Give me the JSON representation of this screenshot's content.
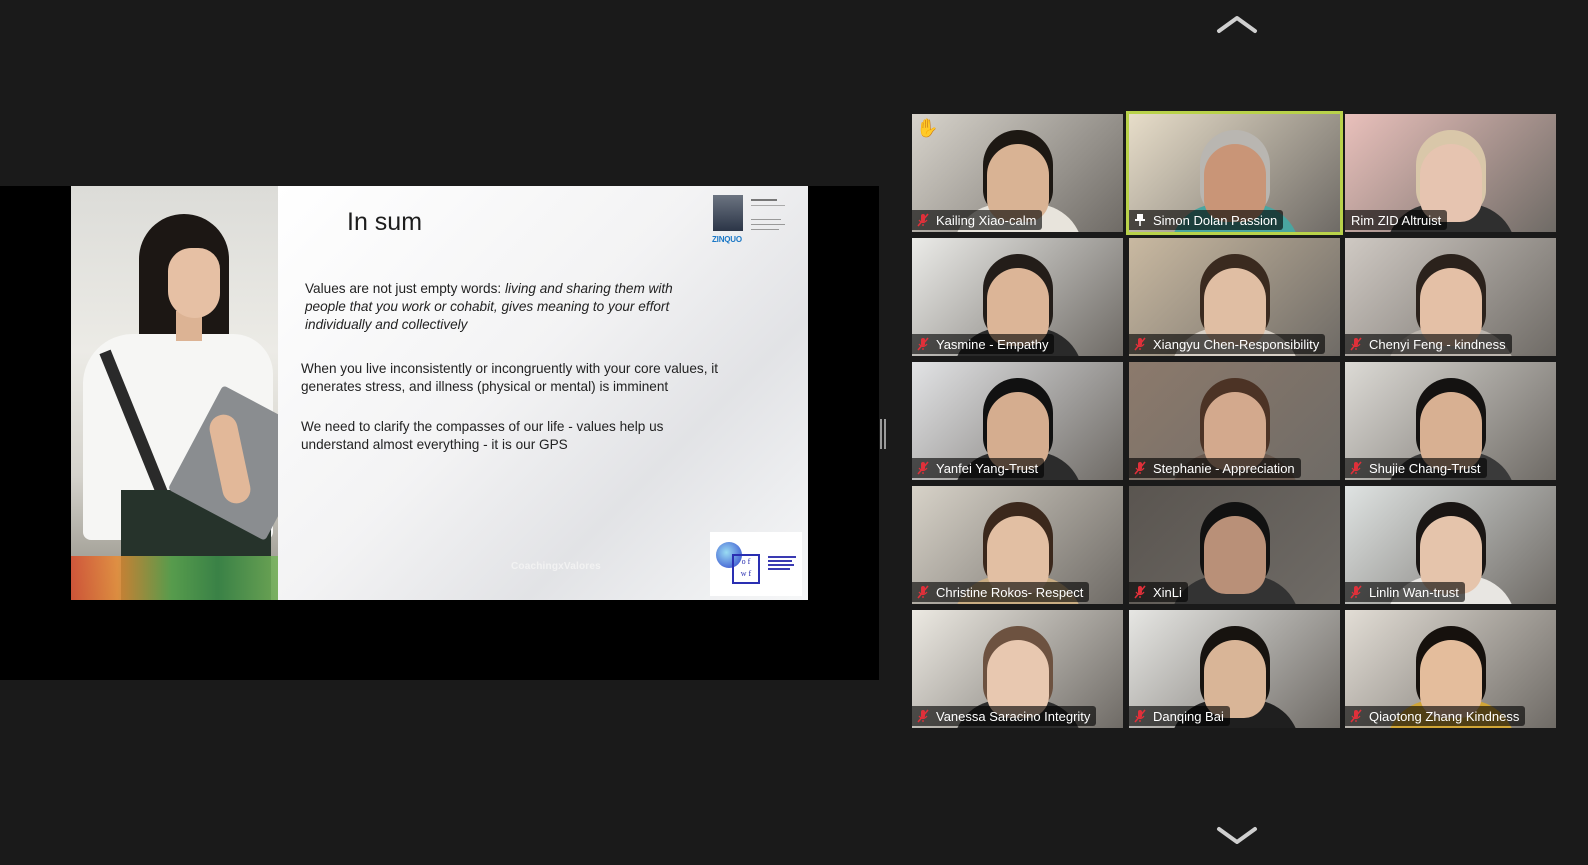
{
  "slide": {
    "title": "In sum",
    "para1_plain": "Values are not just empty words: ",
    "para1_italic": "living and sharing them  with people that you work or cohabit,  gives meaning to your effort individually and collectively",
    "para2": "When you live inconsistently or incongruently with your core values, it  generates  stress, and illness (physical or mental)  is imminent",
    "para3": "We need to clarify the compasses of our life - values help us understand almost everything - it is our GPS",
    "footer": "CoachingxValores",
    "card_brand": "ZINQUO",
    "logo_text": "o f\nw f"
  },
  "colors": {
    "active_speaker": "#b9d24a",
    "muted_mic": "#e0303a",
    "background": "#1a1a1a"
  },
  "gallery": {
    "participants": [
      {
        "name": "Kailing Xiao-calm",
        "muted": true,
        "raised_hand": true,
        "bg": "#d8d4cc",
        "skin": "#d9b394",
        "hair": "#1d1813",
        "cloth": "#e8e4dc"
      },
      {
        "name": "Simon Dolan Passion",
        "muted": false,
        "pinned": true,
        "active": true,
        "bg": "#e7ddc9",
        "skin": "#c99577",
        "hair": "#b9b6b1",
        "cloth": "#4aa5a0"
      },
      {
        "name": "Rim ZID Altruist",
        "muted": false,
        "bg": "#e9c0bb",
        "skin": "#e6c4b0",
        "hair": "#d9c7a9",
        "cloth": "#2f2f2f"
      },
      {
        "name": "Yasmine - Empathy",
        "muted": true,
        "bg": "#ebebe8",
        "skin": "#dcb597",
        "hair": "#231d19",
        "cloth": "#2a2a2a"
      },
      {
        "name": "Xiangyu Chen-Responsibility",
        "muted": true,
        "bg": "#c9b9a1",
        "skin": "#e0bea3",
        "hair": "#3a2a1f",
        "cloth": "#d8d0c6"
      },
      {
        "name": "Chenyi Feng - kindness",
        "muted": true,
        "bg": "#cfc9c3",
        "skin": "#e4c0a6",
        "hair": "#2b221c",
        "cloth": "#bdb6ae"
      },
      {
        "name": "Yanfei Yang-Trust",
        "muted": true,
        "bg": "#e2e3e5",
        "skin": "#d5ad8f",
        "hair": "#111111",
        "cloth": "#2c2c2c"
      },
      {
        "name": "Stephanie - Appreciation",
        "muted": true,
        "bg": "#8c7a6c",
        "skin": "#d3a98d",
        "hair": "#4c3325",
        "cloth": "#6a5a50"
      },
      {
        "name": "Shujie Chang-Trust",
        "muted": true,
        "bg": "#dcdad5",
        "skin": "#d8b092",
        "hair": "#141211",
        "cloth": "#3a3a3a"
      },
      {
        "name": "Christine Rokos- Respect",
        "muted": true,
        "bg": "#d7d2c8",
        "skin": "#e2bfa3",
        "hair": "#3b281c",
        "cloth": "#c9ad83"
      },
      {
        "name": "XinLi",
        "muted": true,
        "bg": "#5a5550",
        "skin": "#b99078",
        "hair": "#111111",
        "cloth": "#333333"
      },
      {
        "name": "Linlin Wan-trust",
        "muted": true,
        "bg": "#dfe3e2",
        "skin": "#e5c4ab",
        "hair": "#1a1614",
        "cloth": "#e8e6e2"
      },
      {
        "name": "Vanessa Saracino Integrity",
        "muted": true,
        "bg": "#ece9e2",
        "skin": "#e8c8b0",
        "hair": "#6d5240",
        "cloth": "#2d2d2d"
      },
      {
        "name": "Danqing Bai",
        "muted": true,
        "bg": "#e6e6e3",
        "skin": "#d9b597",
        "hair": "#17130f",
        "cloth": "#1f1f1f"
      },
      {
        "name": "Qiaotong Zhang Kindness",
        "muted": true,
        "bg": "#e2ddd5",
        "skin": "#e4bd9c",
        "hair": "#16110d",
        "cloth": "#d1a637"
      }
    ]
  }
}
